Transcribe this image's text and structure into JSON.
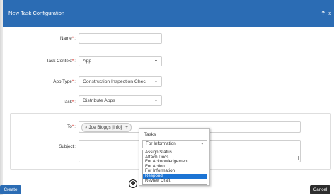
{
  "dialog": {
    "title": "New Task Configuration",
    "help_label": "?",
    "close_label": "x"
  },
  "form": {
    "name": {
      "label": "Name",
      "required_mark": "*",
      "value": ""
    },
    "task_context": {
      "label": "Task Context",
      "required_mark": "*",
      "value": "App"
    },
    "app_type": {
      "label": "App Type",
      "required_mark": "*",
      "value": "Construction Inspection Chec"
    },
    "task": {
      "label": "Task",
      "required_mark": "*",
      "value": "Distribute Apps"
    },
    "to": {
      "label": "To",
      "required_mark": "*",
      "recipient": "Joe Bloggs [Info]",
      "chip_remove": "×",
      "add_icon": "+"
    },
    "subject": {
      "label": "Subject",
      "value": ""
    },
    "colon": ":",
    "caret": "▼"
  },
  "popup": {
    "header": "Tasks",
    "selected": "For Information",
    "caret": "▼",
    "options": [
      "Assign Status",
      "Attach Docs",
      "For Acknowledgement",
      "For Action",
      "For Information",
      "Respond",
      "Review Draft"
    ],
    "highlighted_index": 5,
    "close_glyph": "⊗"
  },
  "buttons": {
    "create": "Create",
    "cancel": "Cancel"
  },
  "colors": {
    "titlebar": "#2b6cb4",
    "required": "#d9241c",
    "selection": "#1c74d4",
    "cancel_button": "#2d2d2d"
  }
}
